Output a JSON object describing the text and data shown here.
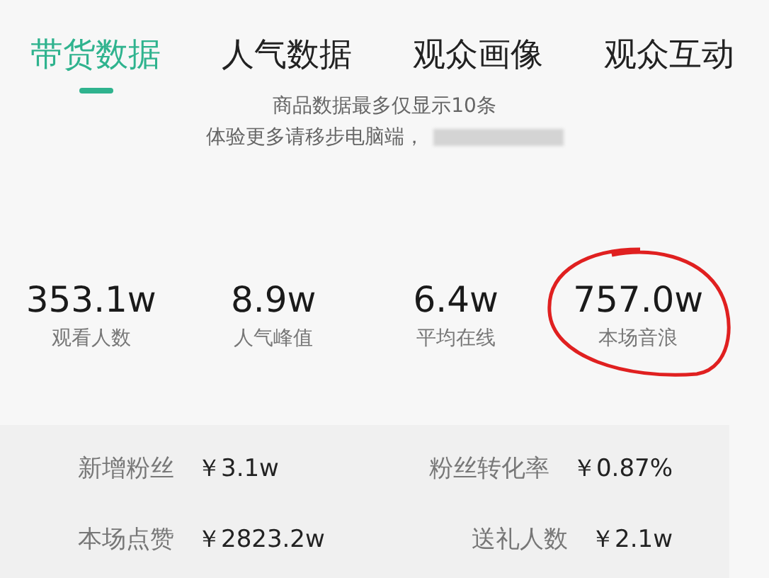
{
  "tabs": [
    {
      "label": "带货数据",
      "selected": true
    },
    {
      "label": "人气数据",
      "selected": false
    },
    {
      "label": "观众画像",
      "selected": false
    },
    {
      "label": "观众互动",
      "selected": false
    }
  ],
  "notice": [
    "商品数据最多仅显示10条",
    "体验更多请移步电脑端，"
  ],
  "stats": [
    {
      "value": "353.1w",
      "label": "观看人数",
      "circled": false
    },
    {
      "value": "8.9w",
      "label": "人气峰值",
      "circled": false
    },
    {
      "value": "6.4w",
      "label": "平均在线",
      "circled": false
    },
    {
      "value": "757.0w",
      "label": "本场音浪",
      "circled": true
    }
  ],
  "details": [
    {
      "label": "新增粉丝",
      "value": "￥3.1w"
    },
    {
      "label": "粉丝转化率",
      "value": "￥0.87%"
    },
    {
      "label": "本场点赞",
      "value": "￥2823.2w"
    },
    {
      "label": "送礼人数",
      "value": "￥2.1w"
    }
  ]
}
